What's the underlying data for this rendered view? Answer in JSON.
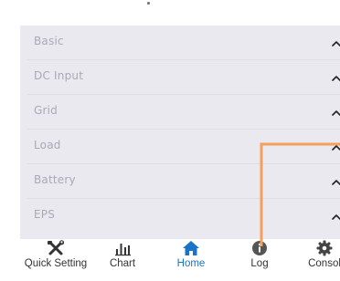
{
  "accordion": {
    "items": [
      {
        "label": "Basic",
        "icon": "chevron-up-icon"
      },
      {
        "label": "DC Input",
        "icon": "chevron-up-icon"
      },
      {
        "label": "Grid",
        "icon": "chevron-up-icon"
      },
      {
        "label": "Load",
        "icon": "chevron-up-icon"
      },
      {
        "label": "Battery",
        "icon": "chevron-up-icon"
      },
      {
        "label": "EPS",
        "icon": "chevron-up-icon"
      }
    ]
  },
  "tabbar": {
    "active": "Home",
    "tabs": [
      {
        "label": "Quick Setting",
        "icon": "tools-icon"
      },
      {
        "label": "Chart",
        "icon": "bar-chart-icon"
      },
      {
        "label": "Home",
        "icon": "home-icon"
      },
      {
        "label": "Log",
        "icon": "info-icon"
      },
      {
        "label": "Consol",
        "icon": "gear-icon"
      }
    ]
  },
  "colors": {
    "panel_bg": "#e9e9ef",
    "row_label": "#a9aab3",
    "accent_active": "#1a73c8",
    "tab_label": "#333333",
    "annotation": "#f5a05a"
  }
}
